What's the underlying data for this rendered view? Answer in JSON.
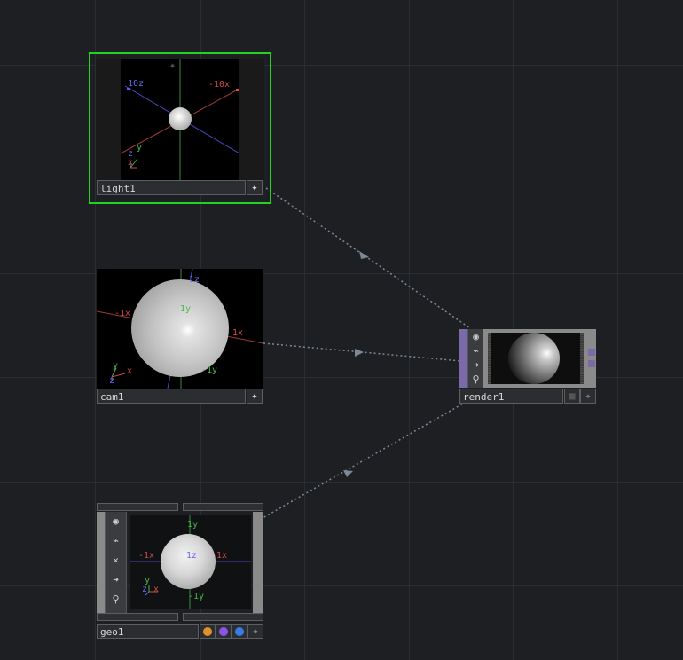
{
  "nodes": {
    "light1": {
      "name": "light1",
      "selected": true,
      "selection_color": "#22d422",
      "axis_labels": {
        "neg_z": "10z",
        "neg_x": "-10x",
        "y": "y",
        "z": "z",
        "x": "x"
      }
    },
    "cam1": {
      "name": "cam1",
      "axis_labels": {
        "neg_x": "-1x",
        "z": "1z",
        "y": "1y",
        "x": "1x",
        "neg_y": "-1y",
        "gnomon_y": "y",
        "gnomon_x": "x",
        "gnomon_z": "z"
      }
    },
    "render1": {
      "name": "render1",
      "flag_icons": [
        "viewer-flag-icon",
        "cook-flag-icon",
        "export-flag-icon",
        "clone-flag-icon"
      ]
    },
    "geo1": {
      "name": "geo1",
      "flag_icons": [
        "display-flag-icon",
        "render-flag-icon",
        "bypass-icon",
        "export-icon",
        "clone-icon"
      ],
      "axis_labels": {
        "y": "1y",
        "neg_x": "-1x",
        "z": "1z",
        "x": "1x",
        "neg_y": "-1y",
        "gnomon_y": "y",
        "gnomon_x": "x",
        "gnomon_z": "z"
      },
      "dot_colors": [
        "#e0922a",
        "#8a55e6",
        "#3a7be6"
      ]
    }
  },
  "colors": {
    "background": "#1d1f22",
    "wire": "#7d8994",
    "render_accent": "#7a6aa8"
  }
}
